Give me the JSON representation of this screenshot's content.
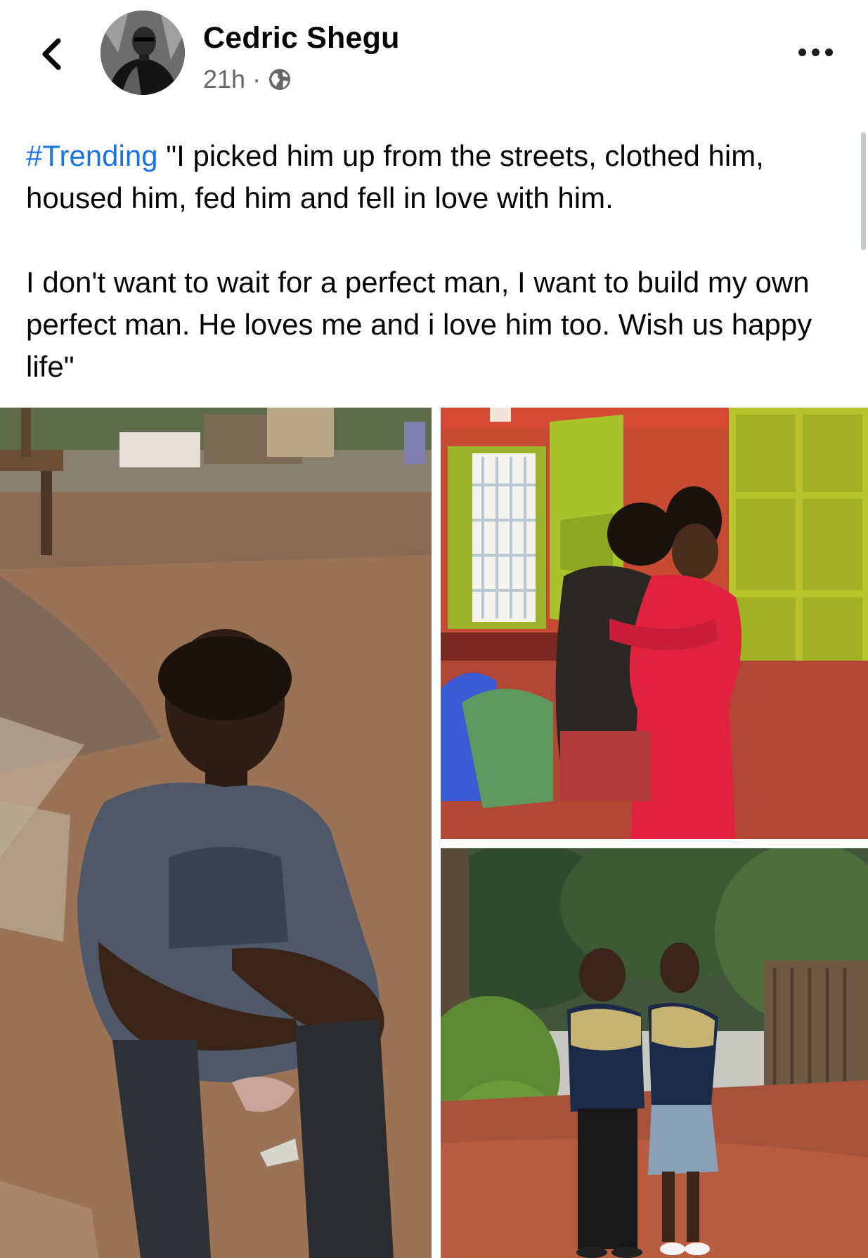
{
  "header": {
    "back_icon": "chevron-left-icon",
    "author_name": "Cedric Shegu",
    "timestamp": "21h",
    "separator": "·",
    "audience_icon": "globe-icon",
    "more_icon": "more-horizontal-icon"
  },
  "post": {
    "hashtag": "#Trending",
    "paragraph_1": " \"I picked him up from the streets, clothed him, housed him, fed him and fell in love with him.",
    "paragraph_2": " I don't want to wait for a perfect man, I want to build my own perfect man. He loves me and i love him too. Wish us happy life\""
  },
  "photos": [
    {
      "subject": "man-sitting-outdoors-photo"
    },
    {
      "subject": "couple-embracing-by-door-photo"
    },
    {
      "subject": "couple-standing-in-garden-photo"
    }
  ],
  "colors": {
    "link_blue": "#1b74e4",
    "secondary_text": "#65676b",
    "primary_text": "#050505"
  }
}
